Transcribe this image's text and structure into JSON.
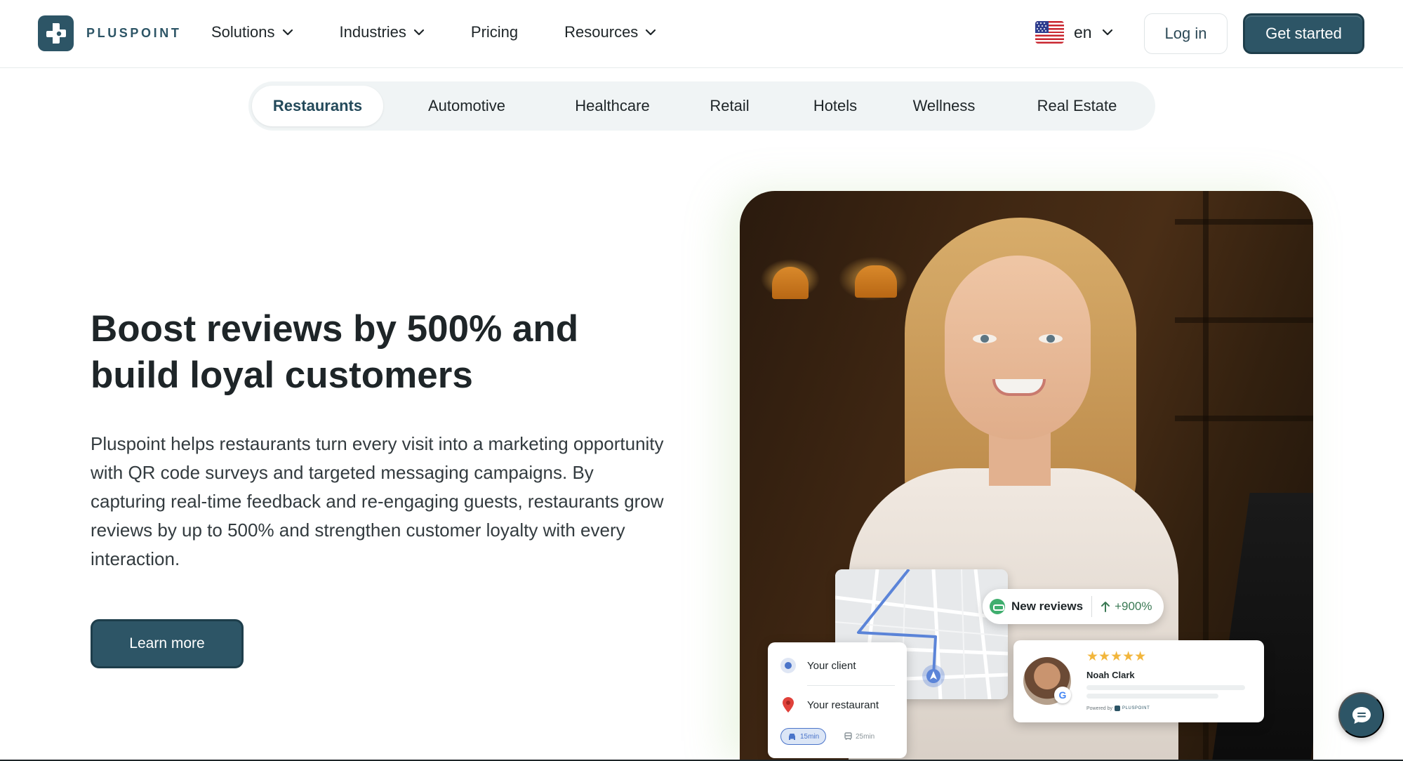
{
  "brand": {
    "name": "PLUSPOINT"
  },
  "nav": {
    "items": [
      {
        "label": "Solutions",
        "has_dropdown": true
      },
      {
        "label": "Industries",
        "has_dropdown": true
      },
      {
        "label": "Pricing",
        "has_dropdown": false
      },
      {
        "label": "Resources",
        "has_dropdown": true
      }
    ],
    "language": {
      "code": "en",
      "flag_icon": "us-flag-icon"
    },
    "login_label": "Log in",
    "cta_label": "Get started"
  },
  "tabs": {
    "active_index": 0,
    "items": [
      {
        "label": "Restaurants"
      },
      {
        "label": "Automotive"
      },
      {
        "label": "Healthcare"
      },
      {
        "label": "Retail"
      },
      {
        "label": "Hotels"
      },
      {
        "label": "Wellness"
      },
      {
        "label": "Real Estate"
      }
    ]
  },
  "hero": {
    "title_line1": "Boost reviews by 500% and",
    "title_line2": "build loyal customers",
    "description": "Pluspoint helps restaurants turn every visit into a marketing opportunity with QR code surveys and targeted messaging campaigns. By capturing real-time feedback and re-engaging guests, restaurants grow reviews by up to 500% and strengthen customer loyalty with every interaction.",
    "cta_label": "Learn more"
  },
  "overlay": {
    "badge": {
      "title": "New reviews",
      "stat": "+900%"
    },
    "route": {
      "client_label": "Your client",
      "restaurant_label": "Your restaurant",
      "drive_time": "15min",
      "walk_time": "25min"
    },
    "review": {
      "rating": 5,
      "stars": "★★★★★",
      "reviewer": "Noah Clark",
      "source_letter": "G",
      "powered_by": "Powered by",
      "powered_brand": "PLUSPOINT"
    }
  },
  "colors": {
    "brand": "#2d5566",
    "brand_dark": "#1e3e4b",
    "text": "#1e2528",
    "tab_bar_bg": "#f0f4f5",
    "star": "#f2b63c",
    "stat_green": "#3b7a55"
  },
  "icons": {
    "chevron": "chevron-down-icon",
    "chat": "chat-bubble-icon",
    "arrow_up": "arrow-up-icon"
  }
}
